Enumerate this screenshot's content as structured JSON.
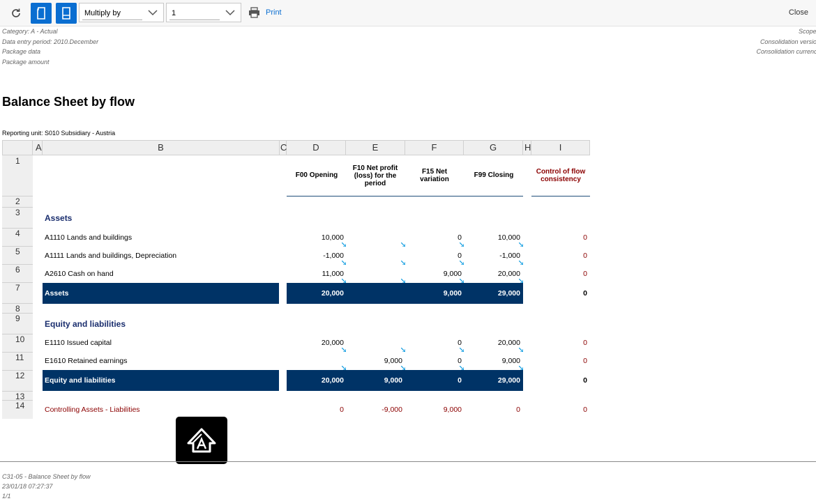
{
  "toolbar": {
    "multiply_label": "Multiply by",
    "multiplier_value": "1",
    "print_label": "Print",
    "close_label": "Close",
    "accent_color": "#0a6ed1"
  },
  "meta_left": [
    "Category: A - Actual",
    "Data entry period: 2010.December",
    "Package data",
    "Package amount"
  ],
  "meta_right": [
    "Scope:",
    "Consolidation version",
    "Consolidation currency"
  ],
  "report": {
    "title": "Balance Sheet by flow",
    "reporting_unit": "Reporting unit: S010 Subsidiary - Austria"
  },
  "columns": [
    "A",
    "B",
    "C",
    "D",
    "E",
    "F",
    "G",
    "H",
    "I"
  ],
  "row_numbers": [
    "1",
    "2",
    "3",
    "4",
    "5",
    "6",
    "7",
    "8",
    "9",
    "10",
    "11",
    "12",
    "13",
    "14"
  ],
  "headers": {
    "d": "F00 Opening",
    "e": "F10 Net profit (loss) for the period",
    "f": "F15 Net variation",
    "g": "F99 Closing",
    "i": "Control of flow consistency"
  },
  "sections": {
    "assets": "Assets",
    "equity": "Equity and liabilities"
  },
  "rows": {
    "a1110": {
      "label": "A1110 Lands and buildings",
      "d": "10,000",
      "e": "",
      "f": "0",
      "g": "10,000",
      "i": "0"
    },
    "a1111": {
      "label": "A1111 Lands and buildings, Depreciation",
      "d": "-1,000",
      "e": "",
      "f": "0",
      "g": "-1,000",
      "i": "0"
    },
    "a2610": {
      "label": "A2610 Cash on hand",
      "d": "11,000",
      "e": "",
      "f": "9,000",
      "g": "20,000",
      "i": "0"
    },
    "assets_total": {
      "label": "Assets",
      "d": "20,000",
      "e": "",
      "f": "9,000",
      "g": "29,000",
      "i": "0"
    },
    "e1110": {
      "label": "E1110 Issued capital",
      "d": "20,000",
      "e": "",
      "f": "0",
      "g": "20,000",
      "i": "0"
    },
    "e1610": {
      "label": "E1610 Retained earnings",
      "d": "",
      "e": "9,000",
      "f": "0",
      "g": "9,000",
      "i": "0"
    },
    "equity_total": {
      "label": "Equity and liabilities",
      "d": "20,000",
      "e": "9,000",
      "f": "0",
      "g": "29,000",
      "i": "0"
    },
    "controlling": {
      "label": "Controlling Assets - Liabilities",
      "d": "0",
      "e": "-9,000",
      "f": "9,000",
      "g": "0",
      "i": "0"
    }
  },
  "footer": [
    "C31-05 - Balance Sheet by flow",
    "23/01/18 07:27:37",
    "1/1"
  ],
  "colors": {
    "total_bar": "#003366",
    "section_text": "#1a2e6e",
    "control_text": "#8b0000"
  }
}
